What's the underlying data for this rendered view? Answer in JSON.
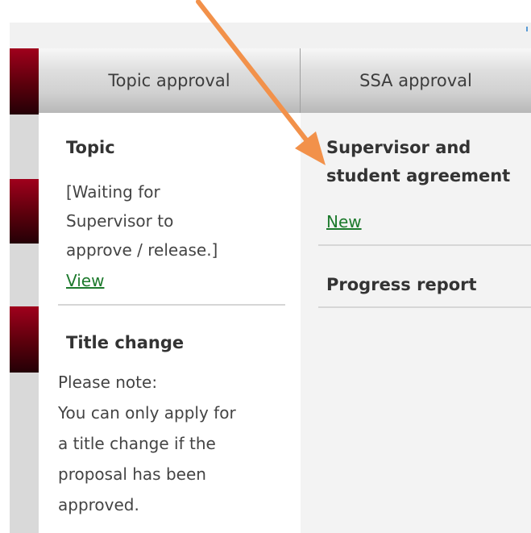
{
  "tabs": [
    {
      "label": "Topic approval"
    },
    {
      "label": "SSA approval"
    }
  ],
  "left": {
    "topic": {
      "heading": "Topic",
      "status_lines": [
        "[Waiting for",
        "Supervisor to",
        "approve / release.]"
      ],
      "link": "View"
    },
    "title_change": {
      "heading": "Title change",
      "note_lines": [
        "Please note:",
        "You can only apply for",
        "a title change if the",
        "proposal has been",
        "approved."
      ]
    }
  },
  "right": {
    "agreement": {
      "heading_lines": [
        "Supervisor and",
        "student agreement"
      ],
      "link": "New"
    },
    "progress": {
      "heading": "Progress report"
    }
  },
  "colors": {
    "accent": "#8a0017",
    "link": "#1d7a2d",
    "arrow": "#f2914a"
  },
  "icons": {
    "annotation": "arrow-icon"
  }
}
